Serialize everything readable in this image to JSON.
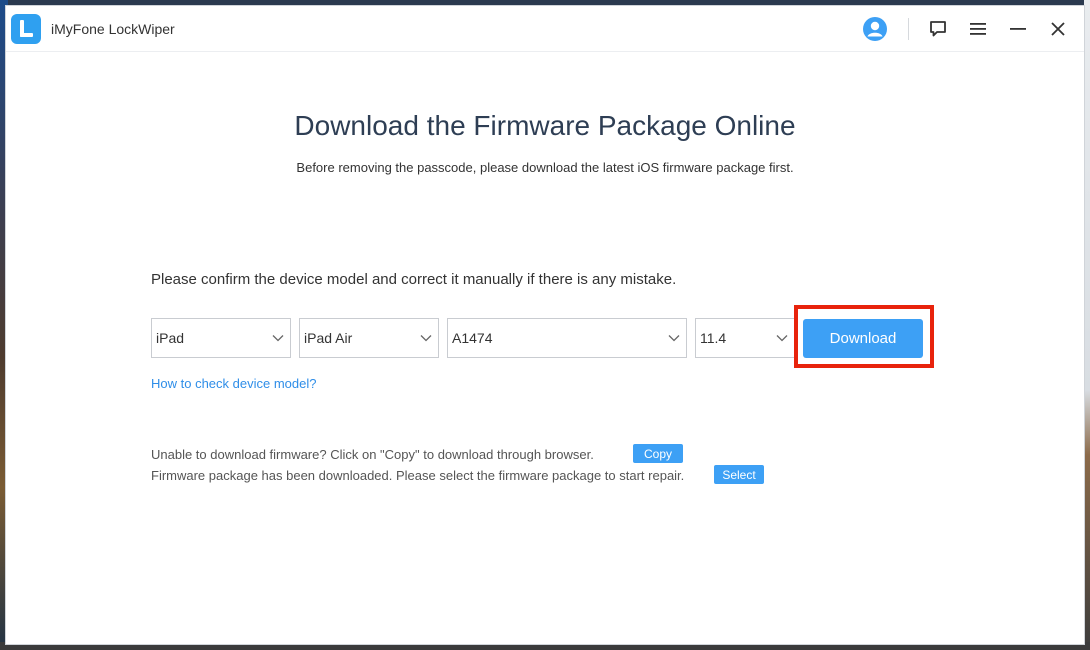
{
  "window": {
    "title": "iMyFone LockWiper"
  },
  "titlebar": {
    "icons": [
      "user-avatar-icon",
      "feedback-icon",
      "menu-icon",
      "minimize-icon",
      "close-icon"
    ]
  },
  "main": {
    "heading": "Download the Firmware Package Online",
    "subheading": "Before removing the passcode, please download the latest iOS firmware package first.",
    "confirm_text": "Please confirm the device model and correct it manually if there is any mistake.",
    "selects": {
      "device": "iPad",
      "model": "iPad Air",
      "model_number": "A1474",
      "ios_version": "11.4"
    },
    "download_label": "Download",
    "check_link": "How to check device model?",
    "copy_text": "Unable to download firmware? Click on \"Copy\" to download through browser.",
    "copy_label": "Copy",
    "select_text": "Firmware package has been downloaded. Please select the firmware package to start repair.",
    "select_label": "Select"
  },
  "colors": {
    "accent": "#3da0f5",
    "highlight": "#e8230c",
    "heading": "#2e3e54",
    "link": "#2f8ee8"
  }
}
